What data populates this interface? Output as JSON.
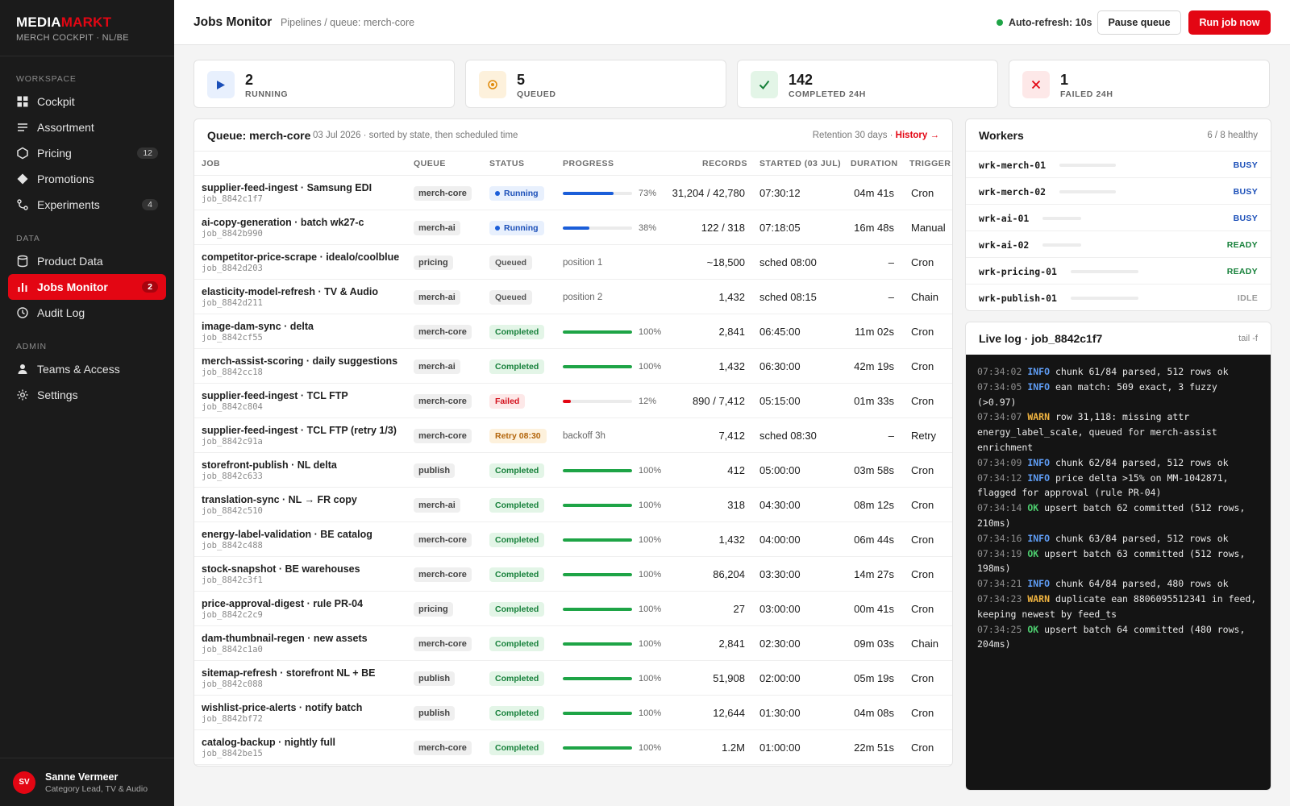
{
  "brand": {
    "logo_a": "MEDIA",
    "logo_b": "MARKT",
    "subtitle": "MERCH COCKPIT · NL/BE"
  },
  "sidebar": {
    "sections": {
      "workspace": "WORKSPACE",
      "data": "DATA",
      "admin": "ADMIN"
    },
    "items": {
      "cockpit": {
        "label": "Cockpit",
        "icon": "grid-icon"
      },
      "assortment": {
        "label": "Assortment",
        "icon": "list-icon"
      },
      "pricing": {
        "label": "Pricing",
        "icon": "hexagon-icon",
        "count": "12"
      },
      "promotions": {
        "label": "Promotions",
        "icon": "tag-icon"
      },
      "experiments": {
        "label": "Experiments",
        "icon": "branch-icon",
        "count": "4"
      },
      "product_data": {
        "label": "Product Data",
        "icon": "database-icon"
      },
      "jobs_monitor": {
        "label": "Jobs Monitor",
        "icon": "bar-chart-icon",
        "count": "2"
      },
      "audit_log": {
        "label": "Audit Log",
        "icon": "clock-icon"
      },
      "teams": {
        "label": "Teams & Access",
        "icon": "user-icon"
      },
      "settings": {
        "label": "Settings",
        "icon": "gear-icon"
      }
    }
  },
  "user": {
    "initials": "SV",
    "name": "Sanne Vermeer",
    "role": "Category Lead, TV & Audio"
  },
  "header": {
    "title": "Jobs Monitor",
    "breadcrumb": "Pipelines / queue: merch-core",
    "autorefresh": "Auto-refresh: 10s",
    "pause_label": "Pause queue",
    "run_label": "Run job now"
  },
  "stats": {
    "running": {
      "value": "2",
      "label": "RUNNING",
      "icon": "play-icon"
    },
    "queued": {
      "value": "5",
      "label": "QUEUED",
      "icon": "pending-icon"
    },
    "completed": {
      "value": "142",
      "label": "COMPLETED 24H",
      "icon": "check-icon"
    },
    "failed": {
      "value": "1",
      "label": "FAILED 24H",
      "icon": "x-icon"
    }
  },
  "queue": {
    "title": "Queue: merch-core",
    "meta": "03 Jul 2026 · sorted by state, then scheduled time",
    "retention": "Retention 30 days · ",
    "history_label": "History →",
    "columns": [
      "JOB",
      "QUEUE",
      "STATUS",
      "PROGRESS",
      "RECORDS",
      "STARTED (03 JUL)",
      "DURATION",
      "TRIGGER"
    ],
    "rows": [
      {
        "name": "supplier-feed-ingest · Samsung EDI",
        "id": "job_8842c1f7",
        "queue": "merch-core",
        "status": "Running",
        "status_type": "running",
        "progress": 73,
        "progress_label": "73%",
        "records": "31,204 / 42,780",
        "started": "07:30:12",
        "duration": "04m 41s",
        "trigger": "Cron"
      },
      {
        "name": "ai-copy-generation · batch wk27-c",
        "id": "job_8842b990",
        "queue": "merch-ai",
        "status": "Running",
        "status_type": "running",
        "progress": 38,
        "progress_label": "38%",
        "records": "122 / 318",
        "started": "07:18:05",
        "duration": "16m 48s",
        "trigger": "Manual"
      },
      {
        "name": "competitor-price-scrape · idealo/coolblue",
        "id": "job_8842d203",
        "queue": "pricing",
        "status": "Queued",
        "status_type": "queued",
        "progress_note": "position 1",
        "records": "~18,500",
        "started": "sched 08:00",
        "duration": "–",
        "trigger": "Cron"
      },
      {
        "name": "elasticity-model-refresh · TV & Audio",
        "id": "job_8842d211",
        "queue": "merch-ai",
        "status": "Queued",
        "status_type": "queued",
        "progress_note": "position 2",
        "records": "1,432",
        "started": "sched 08:15",
        "duration": "–",
        "trigger": "Chain"
      },
      {
        "name": "image-dam-sync · delta",
        "id": "job_8842cf55",
        "queue": "merch-core",
        "status": "Completed",
        "status_type": "completed",
        "progress": 100,
        "progress_label": "100%",
        "records": "2,841",
        "started": "06:45:00",
        "duration": "11m 02s",
        "trigger": "Cron"
      },
      {
        "name": "merch-assist-scoring · daily suggestions",
        "id": "job_8842cc18",
        "queue": "merch-ai",
        "status": "Completed",
        "status_type": "completed",
        "progress": 100,
        "progress_label": "100%",
        "records": "1,432",
        "started": "06:30:00",
        "duration": "42m 19s",
        "trigger": "Cron"
      },
      {
        "name": "supplier-feed-ingest · TCL FTP",
        "id": "job_8842c804",
        "queue": "merch-core",
        "status": "Failed",
        "status_type": "failed",
        "progress": 12,
        "progress_label": "12%",
        "records": "890 / 7,412",
        "started": "05:15:00",
        "duration": "01m 33s",
        "trigger": "Cron"
      },
      {
        "name": "supplier-feed-ingest · TCL FTP (retry 1/3)",
        "id": "job_8842c91a",
        "queue": "merch-core",
        "status": "Retry 08:30",
        "status_type": "retry",
        "progress_note": "backoff 3h",
        "records": "7,412",
        "started": "sched 08:30",
        "duration": "–",
        "trigger": "Retry"
      },
      {
        "name": "storefront-publish · NL delta",
        "id": "job_8842c633",
        "queue": "publish",
        "status": "Completed",
        "status_type": "completed",
        "progress": 100,
        "progress_label": "100%",
        "records": "412",
        "started": "05:00:00",
        "duration": "03m 58s",
        "trigger": "Cron"
      },
      {
        "name": "translation-sync · NL → FR copy",
        "id": "job_8842c510",
        "queue": "merch-ai",
        "status": "Completed",
        "status_type": "completed",
        "progress": 100,
        "progress_label": "100%",
        "records": "318",
        "started": "04:30:00",
        "duration": "08m 12s",
        "trigger": "Cron"
      },
      {
        "name": "energy-label-validation · BE catalog",
        "id": "job_8842c488",
        "queue": "merch-core",
        "status": "Completed",
        "status_type": "completed",
        "progress": 100,
        "progress_label": "100%",
        "records": "1,432",
        "started": "04:00:00",
        "duration": "06m 44s",
        "trigger": "Cron"
      },
      {
        "name": "stock-snapshot · BE warehouses",
        "id": "job_8842c3f1",
        "queue": "merch-core",
        "status": "Completed",
        "status_type": "completed",
        "progress": 100,
        "progress_label": "100%",
        "records": "86,204",
        "started": "03:30:00",
        "duration": "14m 27s",
        "trigger": "Cron"
      },
      {
        "name": "price-approval-digest · rule PR-04",
        "id": "job_8842c2c9",
        "queue": "pricing",
        "status": "Completed",
        "status_type": "completed",
        "progress": 100,
        "progress_label": "100%",
        "records": "27",
        "started": "03:00:00",
        "duration": "00m 41s",
        "trigger": "Cron"
      },
      {
        "name": "dam-thumbnail-regen · new assets",
        "id": "job_8842c1a0",
        "queue": "merch-core",
        "status": "Completed",
        "status_type": "completed",
        "progress": 100,
        "progress_label": "100%",
        "records": "2,841",
        "started": "02:30:00",
        "duration": "09m 03s",
        "trigger": "Chain"
      },
      {
        "name": "sitemap-refresh · storefront NL + BE",
        "id": "job_8842c088",
        "queue": "publish",
        "status": "Completed",
        "status_type": "completed",
        "progress": 100,
        "progress_label": "100%",
        "records": "51,908",
        "started": "02:00:00",
        "duration": "05m 19s",
        "trigger": "Cron"
      },
      {
        "name": "wishlist-price-alerts · notify batch",
        "id": "job_8842bf72",
        "queue": "publish",
        "status": "Completed",
        "status_type": "completed",
        "progress": 100,
        "progress_label": "100%",
        "records": "12,644",
        "started": "01:30:00",
        "duration": "04m 08s",
        "trigger": "Cron"
      },
      {
        "name": "catalog-backup · nightly full",
        "id": "job_8842be15",
        "queue": "merch-core",
        "status": "Completed",
        "status_type": "completed",
        "progress": 100,
        "progress_label": "100%",
        "records": "1.2M",
        "started": "01:00:00",
        "duration": "22m 51s",
        "trigger": "Cron"
      }
    ]
  },
  "workers": {
    "title": "Workers",
    "healthy": "6 / 8 healthy",
    "items": [
      {
        "name": "wrk-merch-01",
        "state": "BUSY"
      },
      {
        "name": "wrk-merch-02",
        "state": "BUSY"
      },
      {
        "name": "wrk-ai-01",
        "state": "BUSY"
      },
      {
        "name": "wrk-ai-02",
        "state": "READY"
      },
      {
        "name": "wrk-pricing-01",
        "state": "READY"
      },
      {
        "name": "wrk-publish-01",
        "state": "IDLE"
      }
    ]
  },
  "livelog": {
    "title": "Live log · job_8842c1f7",
    "tail": "tail -f",
    "lines": [
      {
        "ts": "07:34:02",
        "level": "INFO",
        "msg": "chunk 61/84 parsed, 512 rows ok"
      },
      {
        "ts": "07:34:05",
        "level": "INFO",
        "msg": "ean match: 509 exact, 3 fuzzy (>0.97)"
      },
      {
        "ts": "07:34:07",
        "level": "WARN",
        "msg": "row 31,118: missing attr energy_label_scale, queued for merch-assist enrichment"
      },
      {
        "ts": "07:34:09",
        "level": "INFO",
        "msg": "chunk 62/84 parsed, 512 rows ok"
      },
      {
        "ts": "07:34:12",
        "level": "INFO",
        "msg": "price delta >15% on MM-1042871, flagged for approval (rule PR-04)"
      },
      {
        "ts": "07:34:14",
        "level": "OK",
        "msg": "upsert batch 62 committed (512 rows, 210ms)"
      },
      {
        "ts": "07:34:16",
        "level": "INFO",
        "msg": "chunk 63/84 parsed, 512 rows ok"
      },
      {
        "ts": "07:34:19",
        "level": "OK",
        "msg": "upsert batch 63 committed (512 rows, 198ms)"
      },
      {
        "ts": "07:34:21",
        "level": "INFO",
        "msg": "chunk 64/84 parsed, 480 rows ok"
      },
      {
        "ts": "07:34:23",
        "level": "WARN",
        "msg": "duplicate ean 8806095512341 in feed, keeping newest by feed_ts"
      },
      {
        "ts": "07:34:25",
        "level": "OK",
        "msg": "upsert batch 64 committed (480 rows, 204ms)"
      }
    ]
  }
}
